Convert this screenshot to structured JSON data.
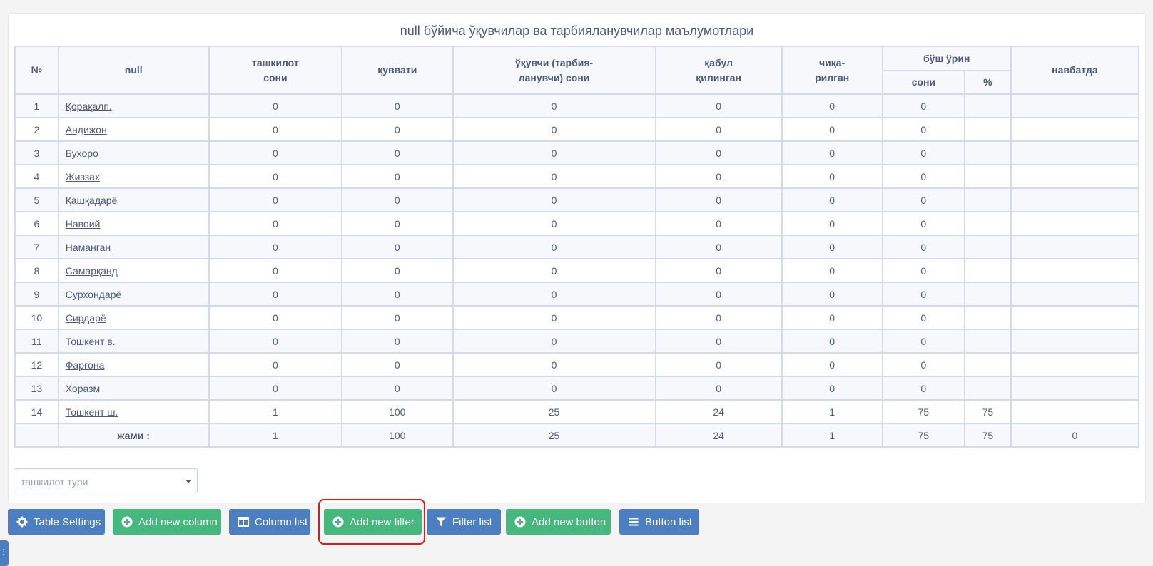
{
  "title": "null бўйича ўқувчилар ва тарбияланувчилар маълумотлари",
  "table": {
    "headers": {
      "num": "№",
      "name": "null",
      "orgs": "ташкилот сони",
      "capacity": "қуввати",
      "students": "ўқувчи (тарбия-ланувчи) сони",
      "admitted": "қабул қилинган",
      "released": "чиқа-рилган",
      "vacancy": "бўш ўрин",
      "vacancy_count": "сони",
      "vacancy_pct": "%",
      "queue": "навбатда"
    },
    "rows": [
      {
        "num": "1",
        "name": "Қорақалп.",
        "orgs": "0",
        "capacity": "0",
        "students": "0",
        "admitted": "0",
        "released": "0",
        "vacancy": "0",
        "pct": "",
        "queue": ""
      },
      {
        "num": "2",
        "name": "Андижон",
        "orgs": "0",
        "capacity": "0",
        "students": "0",
        "admitted": "0",
        "released": "0",
        "vacancy": "0",
        "pct": "",
        "queue": ""
      },
      {
        "num": "3",
        "name": "Бухоро",
        "orgs": "0",
        "capacity": "0",
        "students": "0",
        "admitted": "0",
        "released": "0",
        "vacancy": "0",
        "pct": "",
        "queue": ""
      },
      {
        "num": "4",
        "name": "Жиззах",
        "orgs": "0",
        "capacity": "0",
        "students": "0",
        "admitted": "0",
        "released": "0",
        "vacancy": "0",
        "pct": "",
        "queue": ""
      },
      {
        "num": "5",
        "name": "Қашқадарё",
        "orgs": "0",
        "capacity": "0",
        "students": "0",
        "admitted": "0",
        "released": "0",
        "vacancy": "0",
        "pct": "",
        "queue": ""
      },
      {
        "num": "6",
        "name": "Навоий",
        "orgs": "0",
        "capacity": "0",
        "students": "0",
        "admitted": "0",
        "released": "0",
        "vacancy": "0",
        "pct": "",
        "queue": ""
      },
      {
        "num": "7",
        "name": "Наманган",
        "orgs": "0",
        "capacity": "0",
        "students": "0",
        "admitted": "0",
        "released": "0",
        "vacancy": "0",
        "pct": "",
        "queue": ""
      },
      {
        "num": "8",
        "name": "Самарқанд",
        "orgs": "0",
        "capacity": "0",
        "students": "0",
        "admitted": "0",
        "released": "0",
        "vacancy": "0",
        "pct": "",
        "queue": ""
      },
      {
        "num": "9",
        "name": "Сурхондарё",
        "orgs": "0",
        "capacity": "0",
        "students": "0",
        "admitted": "0",
        "released": "0",
        "vacancy": "0",
        "pct": "",
        "queue": ""
      },
      {
        "num": "10",
        "name": "Сирдарё",
        "orgs": "0",
        "capacity": "0",
        "students": "0",
        "admitted": "0",
        "released": "0",
        "vacancy": "0",
        "pct": "",
        "queue": ""
      },
      {
        "num": "11",
        "name": "Тошкент в.",
        "orgs": "0",
        "capacity": "0",
        "students": "0",
        "admitted": "0",
        "released": "0",
        "vacancy": "0",
        "pct": "",
        "queue": ""
      },
      {
        "num": "12",
        "name": "Фарғона",
        "orgs": "0",
        "capacity": "0",
        "students": "0",
        "admitted": "0",
        "released": "0",
        "vacancy": "0",
        "pct": "",
        "queue": ""
      },
      {
        "num": "13",
        "name": "Хоразм",
        "orgs": "0",
        "capacity": "0",
        "students": "0",
        "admitted": "0",
        "released": "0",
        "vacancy": "0",
        "pct": "",
        "queue": ""
      },
      {
        "num": "14",
        "name": "Тошкент ш.",
        "orgs": "1",
        "capacity": "100",
        "students": "25",
        "admitted": "24",
        "released": "1",
        "vacancy": "75",
        "pct": "75",
        "queue": ""
      }
    ],
    "total": {
      "label": "жами :",
      "orgs": "1",
      "capacity": "100",
      "students": "25",
      "admitted": "24",
      "released": "1",
      "vacancy": "75",
      "pct": "75",
      "queue": "0"
    }
  },
  "colors": {
    "pct_row": "#1a8a1a",
    "pct_total": "#e23b3b",
    "button_blue": "#4c7fc1",
    "button_green": "#45b87e",
    "highlight": "#e01818"
  },
  "filter": {
    "placeholder": "ташкилот тури"
  },
  "toolbar": {
    "table_settings": "Table Settings",
    "add_column": "Add new column",
    "column_list": "Column list",
    "add_filter": "Add new filter",
    "filter_list": "Filter list",
    "add_button": "Add new button",
    "button_list": "Button list"
  }
}
